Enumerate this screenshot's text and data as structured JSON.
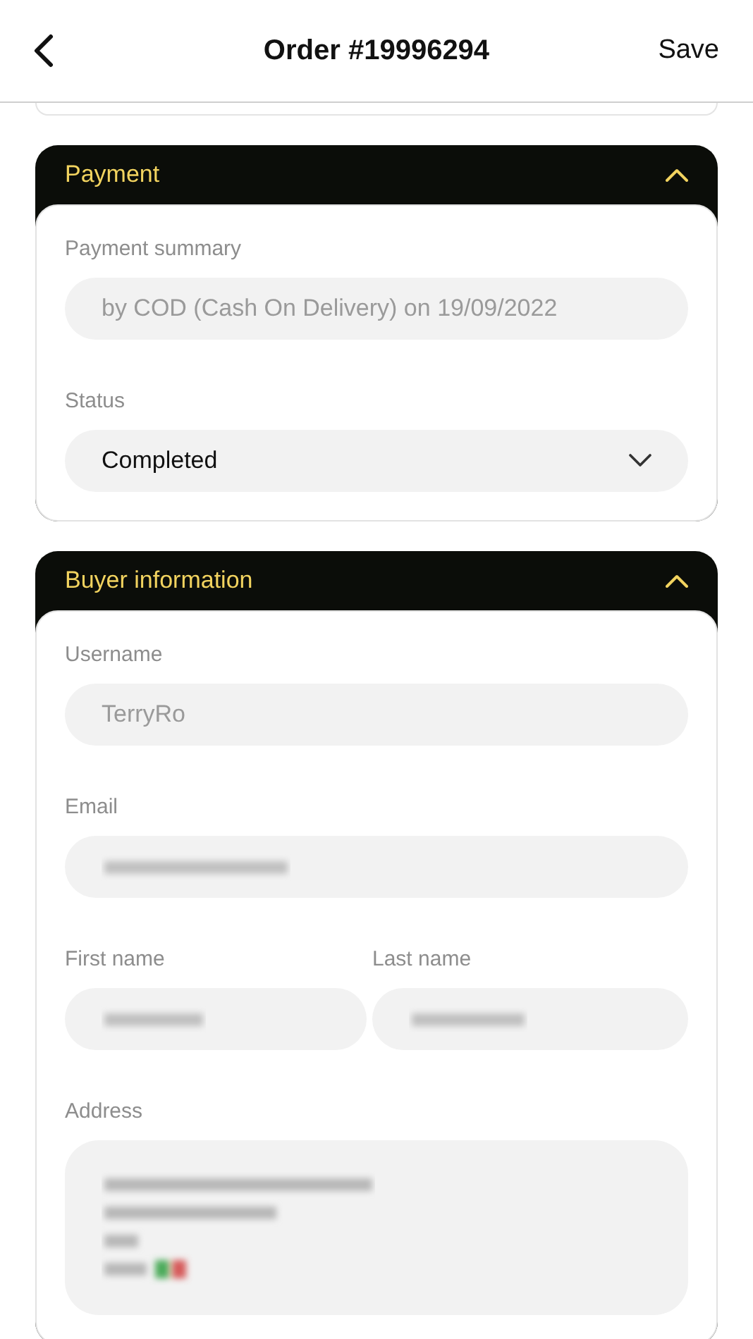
{
  "header": {
    "title": "Order #19996294",
    "action": "Save"
  },
  "sections": [
    {
      "title": "Payment",
      "expanded": true,
      "rows": [
        [
          {
            "label": "Payment summary",
            "kind": "text",
            "value": "by COD (Cash On Delivery) on 19/09/2022",
            "disabled": true,
            "redacted": false
          }
        ],
        [
          {
            "label": "Status",
            "kind": "select",
            "value": "Completed",
            "disabled": false,
            "redacted": false
          }
        ]
      ]
    },
    {
      "title": "Buyer information",
      "expanded": true,
      "rows": [
        [
          {
            "label": "Username",
            "kind": "text",
            "value": "TerryRo",
            "disabled": true,
            "redacted": false
          }
        ],
        [
          {
            "label": "Email",
            "kind": "text",
            "disabled": true,
            "redacted": true
          }
        ],
        [
          {
            "label": "First name",
            "kind": "text",
            "disabled": true,
            "redacted": true
          },
          {
            "label": "Last name",
            "kind": "text",
            "disabled": true,
            "redacted": true
          }
        ],
        [
          {
            "label": "Address",
            "kind": "textarea",
            "disabled": true,
            "redacted": true
          }
        ]
      ]
    }
  ]
}
